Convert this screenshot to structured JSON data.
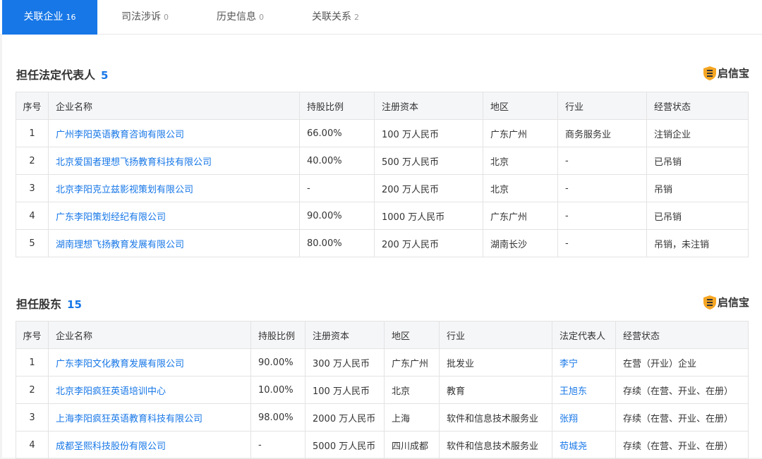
{
  "tabs": [
    {
      "label": "关联企业",
      "count": "16",
      "active": true
    },
    {
      "label": "司法涉诉",
      "count": "0",
      "active": false
    },
    {
      "label": "历史信息",
      "count": "0",
      "active": false
    },
    {
      "label": "关联关系",
      "count": "2",
      "active": false
    }
  ],
  "brand": {
    "name": "启信宝",
    "icon": "qixinbao-logo-icon",
    "color": "#f5a623"
  },
  "legal_rep": {
    "title": "担任法定代表人",
    "count": "5",
    "headers": [
      "序号",
      "企业名称",
      "持股比例",
      "注册资本",
      "地区",
      "行业",
      "经营状态"
    ],
    "rows": [
      [
        "1",
        "广州李阳英语教育咨询有限公司",
        "66.00%",
        "100 万人民币",
        "广东广州",
        "商务服务业",
        "注销企业"
      ],
      [
        "2",
        "北京爱国者理想飞扬教育科技有限公司",
        "40.00%",
        "500 万人民币",
        "北京",
        "-",
        "已吊销"
      ],
      [
        "3",
        "北京李阳克立兹影视策划有限公司",
        "-",
        "200 万人民币",
        "北京",
        "-",
        "吊销"
      ],
      [
        "4",
        "广东李阳策划经纪有限公司",
        "90.00%",
        "1000 万人民币",
        "广东广州",
        "-",
        "已吊销"
      ],
      [
        "5",
        "湖南理想飞扬教育发展有限公司",
        "80.00%",
        "200 万人民币",
        "湖南长沙",
        "-",
        "吊销，未注销"
      ]
    ]
  },
  "shareholder": {
    "title": "担任股东",
    "count": "15",
    "headers": [
      "序号",
      "企业名称",
      "持股比例",
      "注册资本",
      "地区",
      "行业",
      "法定代表人",
      "经营状态"
    ],
    "rows": [
      [
        "1",
        "广东李阳文化教育发展有限公司",
        "90.00%",
        "300 万人民币",
        "广东广州",
        "批发业",
        "李宁",
        "在营（开业）企业"
      ],
      [
        "2",
        "北京李阳疯狂英语培训中心",
        "10.00%",
        "100 万人民币",
        "北京",
        "教育",
        "王旭东",
        "存续（在营、开业、在册）"
      ],
      [
        "3",
        "上海李阳疯狂英语教育科技有限公司",
        "98.00%",
        "2000 万人民币",
        "上海",
        "软件和信息技术服务业",
        "张翔",
        "存续（在营、开业、在册）"
      ],
      [
        "4",
        "成都圣熙科技股份有限公司",
        "-",
        "5000 万人民币",
        "四川成都",
        "软件和信息技术服务业",
        "苟城尧",
        "存续（在营、开业、在册）"
      ]
    ]
  },
  "colors": {
    "accent": "#1777e7",
    "header_bg": "#f5f6f8",
    "border": "#e3e3e3"
  }
}
